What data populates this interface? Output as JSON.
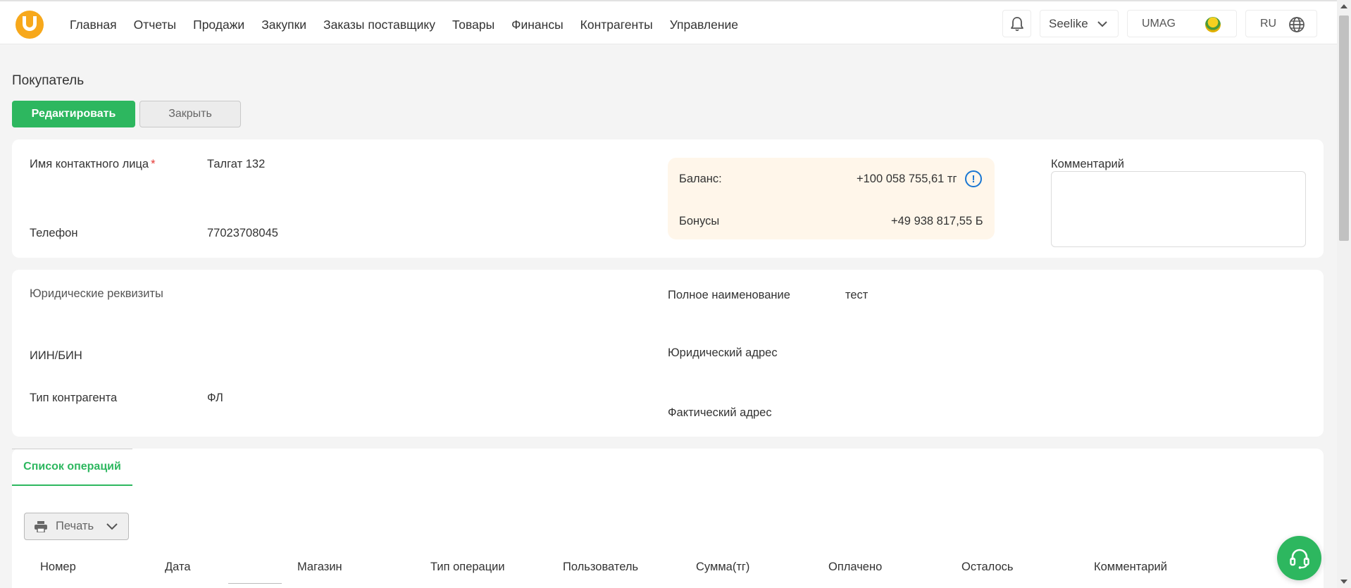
{
  "nav": {
    "items": [
      "Главная",
      "Отчеты",
      "Продажи",
      "Закупки",
      "Заказы поставщику",
      "Товары",
      "Финансы",
      "Контрагенты",
      "Управление"
    ]
  },
  "header": {
    "org_name": "Seelike",
    "brand": "UMAG",
    "language": "RU"
  },
  "page": {
    "title": "Покупатель",
    "edit_label": "Редактировать",
    "close_label": "Закрыть"
  },
  "contact": {
    "name_label": "Имя контактного лица",
    "required_mark": "*",
    "name_value": "Талгат 132",
    "phone_label": "Телефон",
    "phone_value": "77023708045"
  },
  "balance": {
    "balance_label": "Баланс:",
    "balance_value": "+100 058 755,61 тг",
    "bonus_label": "Бонусы",
    "bonus_value": "+49 938 817,55 Б"
  },
  "comment": {
    "label": "Комментарий",
    "value": ""
  },
  "legal": {
    "section_label": "Юридические реквизиты",
    "iin_label": "ИИН/БИН",
    "iin_value": "",
    "type_label": "Тип контрагента",
    "type_value": "ФЛ",
    "fullname_label": "Полное наименование",
    "fullname_value": "тест",
    "legal_address_label": "Юридический адрес",
    "legal_address_value": "",
    "actual_address_label": "Фактический адрес",
    "actual_address_value": ""
  },
  "operations": {
    "tab_label": "Список операций",
    "print_label": "Печать",
    "columns": [
      "Номер",
      "Дата",
      "Магазин",
      "Тип операции",
      "Пользователь",
      "Сумма(тг)",
      "Оплачено",
      "Осталось",
      "Комментарий"
    ]
  },
  "colors": {
    "accent_green": "#2db75f",
    "logo_orange": "#f7a81b",
    "balance_bg": "#fff6ea",
    "info_blue": "#1976d2"
  },
  "icons": {
    "bell": "bell-icon",
    "chevron": "chevron-down-icon",
    "globe": "globe-icon",
    "info": "info-icon",
    "printer": "printer-icon",
    "support": "headset-icon"
  }
}
